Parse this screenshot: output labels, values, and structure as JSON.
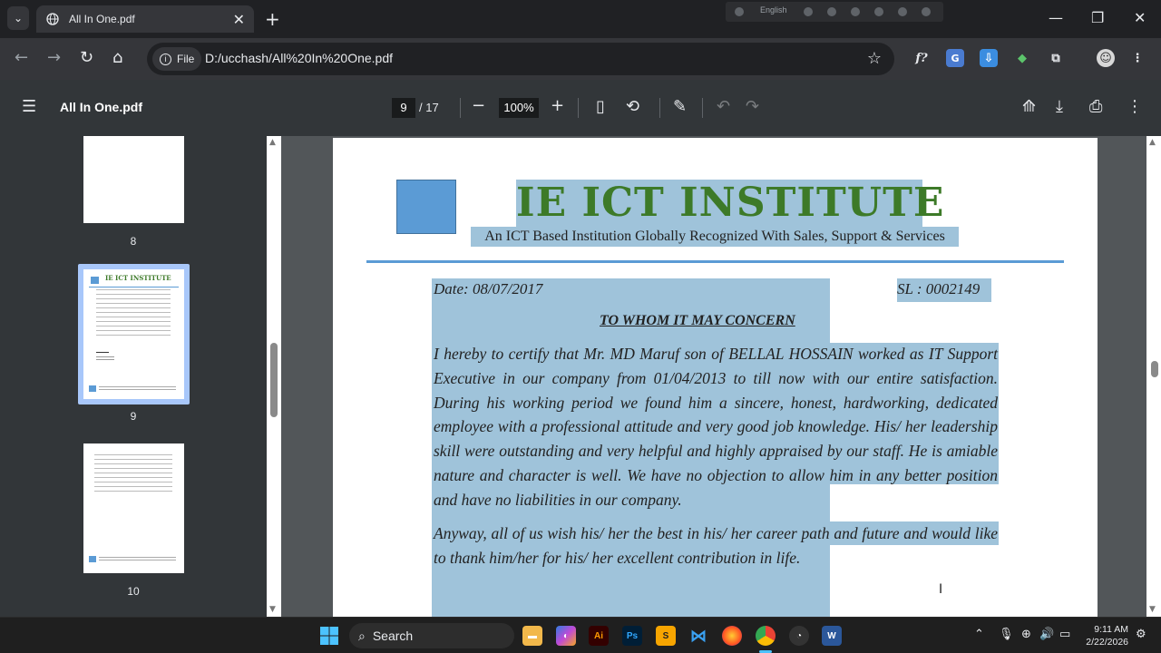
{
  "browser": {
    "tab_title": "All In One.pdf",
    "url_chip": "File",
    "url": "D:/ucchash/All%20In%20One.pdf",
    "language_label": "English"
  },
  "pdf_toolbar": {
    "doc_title": "All In One.pdf",
    "current_page": "9",
    "total_pages": "/ 17",
    "zoom": "100%"
  },
  "sidebar": {
    "thumbs": [
      {
        "label": "8"
      },
      {
        "label": "9"
      },
      {
        "label": "10"
      }
    ],
    "mini_title": "IE ICT INSTITUTE"
  },
  "document": {
    "institute_title": "IE ICT INSTITUTE",
    "subtitle": "An ICT Based Institution Globally Recognized With Sales, Support & Services",
    "date": "Date: 08/07/2017",
    "serial": "SL : 0002149",
    "heading": "TO WHOM IT MAY CONCERN",
    "paragraph1": "I hereby to certify that Mr. MD Maruf son of BELLAL HOSSAIN worked as IT Support Executive in our company from 01/04/2013 to till now with our entire satisfaction. During his working period we found him a sincere, honest, hardworking, dedicated employee with a professional attitude and very good job knowledge. His/ her leadership skill were outstanding and very helpful and highly appraised by our staff. He is amiable nature and character is well. We have no objection to allow him in any better position and have no liabilities in our company.",
    "paragraph2": "Anyway, all of us wish his/ her the best in his/ her career path and future and would like to thank him/her for his/ her excellent contribution in life."
  },
  "taskbar": {
    "search_label": "Search",
    "time": "9:11 AM",
    "date": "2/22/2026"
  },
  "colors": {
    "title_green": "#3d7a28",
    "logo_blue": "#5b9bd5",
    "highlight": "#9fc3da",
    "toolbar_bg": "#323639"
  }
}
